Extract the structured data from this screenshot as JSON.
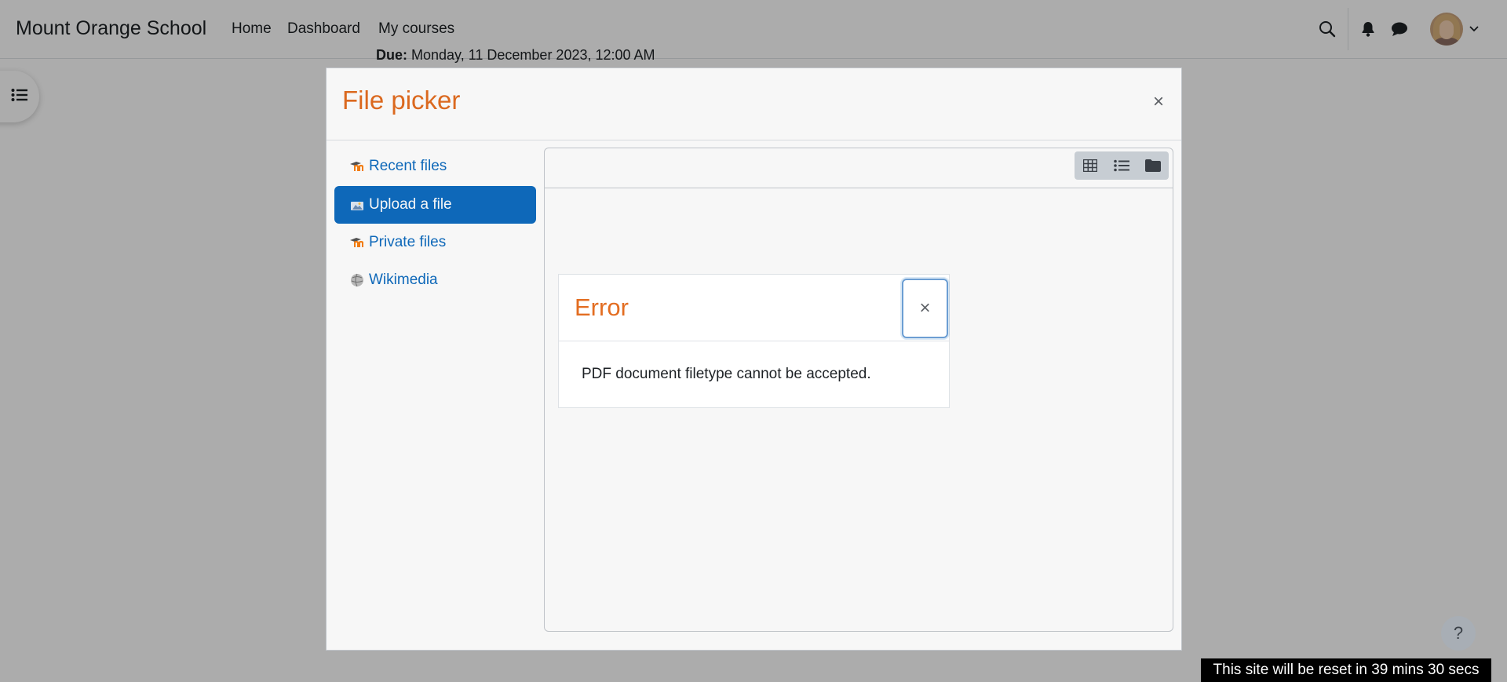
{
  "navbar": {
    "brand": "Mount Orange School",
    "links": [
      "Home",
      "Dashboard",
      "My courses"
    ]
  },
  "page": {
    "due_label": "Due:",
    "due_value": "Monday, 11 December 2023, 12:00 AM"
  },
  "filepicker": {
    "title": "File picker",
    "close_glyph": "×",
    "repositories": [
      {
        "label": "Recent files",
        "icon": "moodle-icon",
        "active": false
      },
      {
        "label": "Upload a file",
        "icon": "upload-icon",
        "active": true
      },
      {
        "label": "Private files",
        "icon": "moodle-icon",
        "active": false
      },
      {
        "label": "Wikimedia",
        "icon": "wikimedia-icon",
        "active": false
      }
    ],
    "view_modes": [
      "grid-icon",
      "list-icon",
      "folder-icon"
    ]
  },
  "error_dialog": {
    "title": "Error",
    "close_glyph": "×",
    "message": "PDF document filetype cannot be accepted."
  },
  "footer": {
    "help_glyph": "?",
    "reset_notice": "This site will be reset in 39 mins 30 secs"
  },
  "colors": {
    "accent": "#0f6cbf",
    "title": "#e36d21",
    "backdrop": "rgba(0,0,0,0.3)"
  }
}
